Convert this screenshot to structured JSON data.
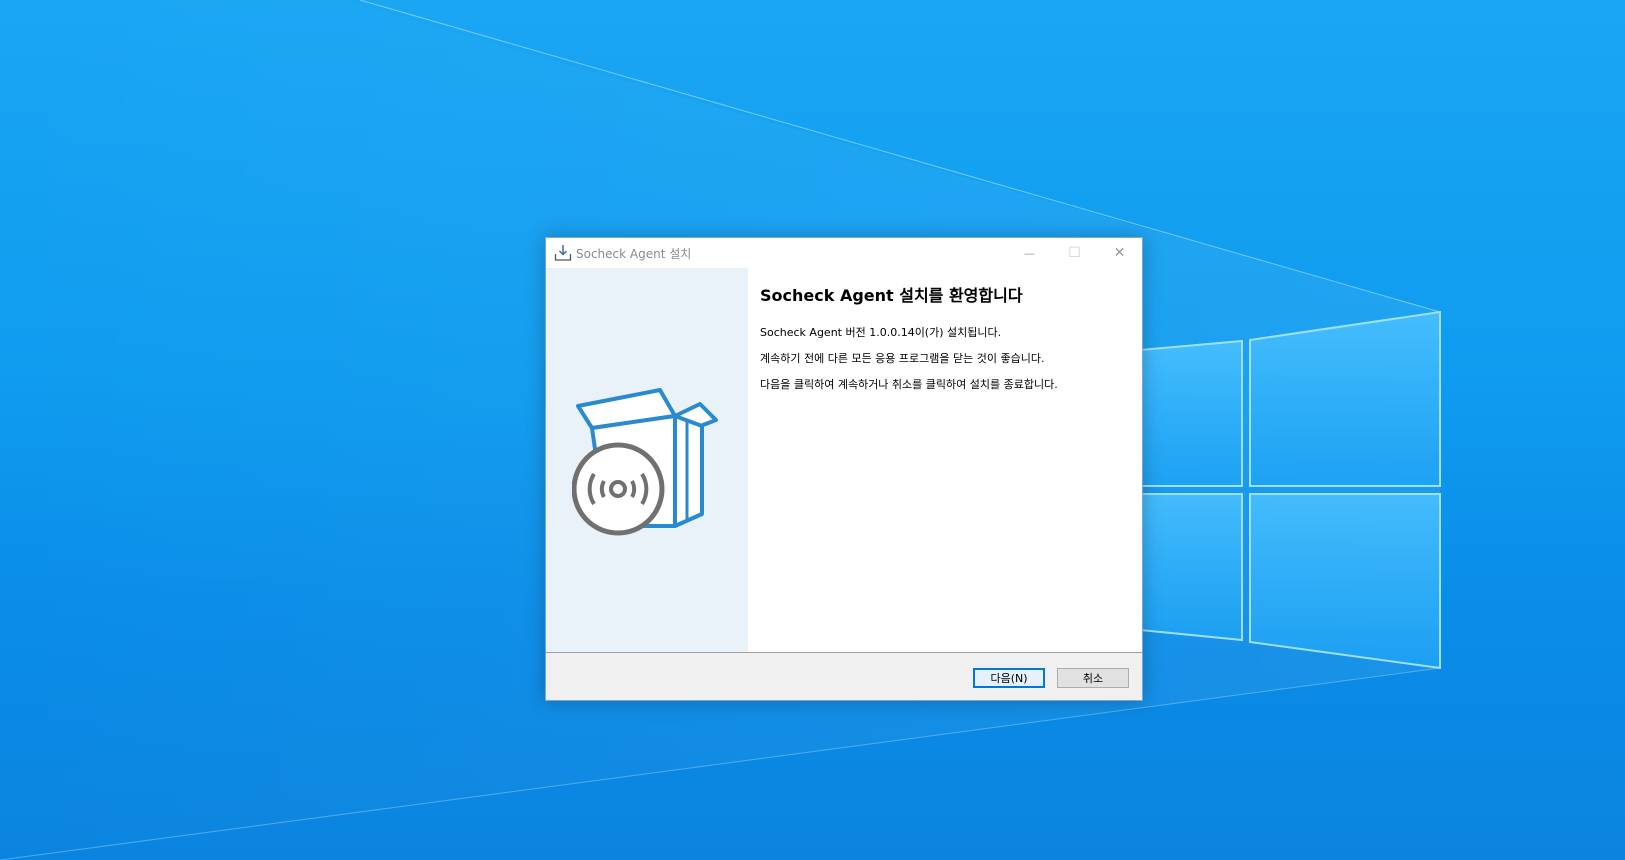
{
  "window": {
    "title": "Socheck Agent 설치",
    "minimize_label": "—",
    "maximize_label": "☐",
    "close_label": "✕"
  },
  "content": {
    "heading": "Socheck Agent 설치를 환영합니다",
    "line1": "Socheck Agent 버전 1.0.0.14이(가) 설치됩니다.",
    "line2": "계속하기 전에 다른 모든 응용 프로그램을 닫는 것이 좋습니다.",
    "line3": "다음을 클릭하여 계속하거나 취소를 클릭하여 설치를 종료합니다."
  },
  "buttons": {
    "next_label": "다음(N)",
    "cancel_label": "취소"
  },
  "colors": {
    "accent": "#0078d7",
    "side_panel": "#e8f2f8",
    "box_blue": "#2a8ad0",
    "disc_gray": "#707070"
  },
  "icons": {
    "title": "installer-icon",
    "art": "box-with-disc-icon"
  }
}
